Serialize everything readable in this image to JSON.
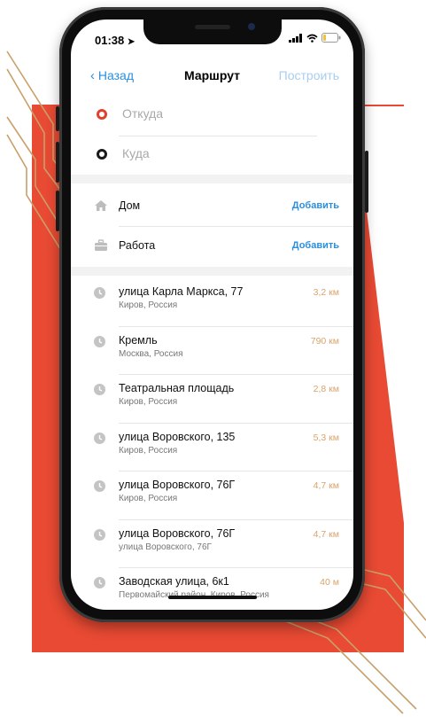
{
  "status": {
    "time": "01:38"
  },
  "nav": {
    "back_label": "Назад",
    "title": "Маршрут",
    "build_label": "Построить"
  },
  "points": {
    "from_placeholder": "Откуда",
    "to_placeholder": "Куда"
  },
  "saved": [
    {
      "label": "Дом",
      "action": "Добавить",
      "icon": "home-icon"
    },
    {
      "label": "Работа",
      "action": "Добавить",
      "icon": "briefcase-icon"
    }
  ],
  "history": [
    {
      "title": "улица Карла Маркса, 77",
      "subtitle": "Киров, Россия",
      "distance": "3,2 км"
    },
    {
      "title": "Кремль",
      "subtitle": "Москва, Россия",
      "distance": "790 км"
    },
    {
      "title": "Театральная площадь",
      "subtitle": "Киров, Россия",
      "distance": "2,8 км"
    },
    {
      "title": "улица Воровского, 135",
      "subtitle": "Киров, Россия",
      "distance": "5,3 км"
    },
    {
      "title": "улица Воровского, 76Г",
      "subtitle": "Киров, Россия",
      "distance": "4,7 км"
    },
    {
      "title": "улица Воровского, 76Г",
      "subtitle": "улица Воровского, 76Г",
      "distance": "4,7 км"
    },
    {
      "title": "Заводская улица, 6к1",
      "subtitle": "Первомайский район, Киров, Россия",
      "distance": "40 м"
    }
  ],
  "colors": {
    "accent": "#2a8fe0",
    "from_dot": "#e0412f",
    "distance": "#d8a46b",
    "background_block": "#e84a33"
  }
}
